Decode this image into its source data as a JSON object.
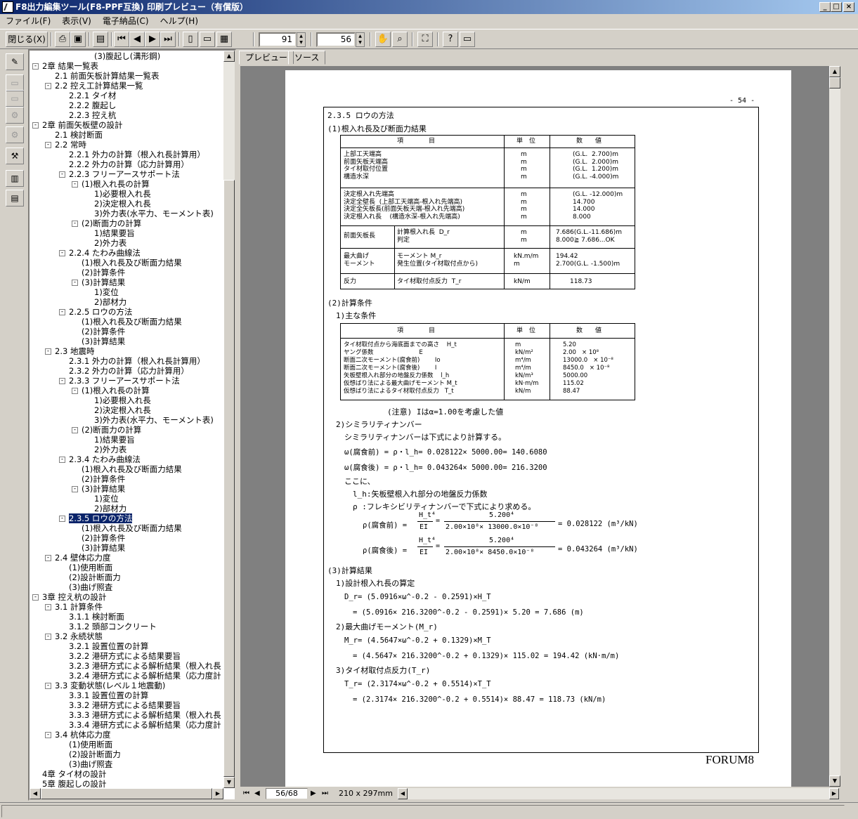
{
  "window": {
    "title": "F8出力編集ツール(F8-PPF互換) 印刷プレビュー（有償版）",
    "min": "_",
    "max": "□",
    "close": "×"
  },
  "menu": [
    "ファイル(F)",
    "表示(V)",
    "電子納品(C)",
    "ヘルプ(H)"
  ],
  "toolbar": {
    "close_label": "閉じる(X)",
    "zoom_value": "91",
    "page_value": "56"
  },
  "tabs": [
    "プレビュー",
    "ソース"
  ],
  "tree": [
    {
      "t": "(3)腹起し(溝形鋼)",
      "d": 4
    },
    {
      "t": "2章 結果一覧表",
      "d": 0,
      "x": "-"
    },
    {
      "t": "2.1 前面矢板計算結果一覧表",
      "d": 1
    },
    {
      "t": "2.2 控え工計算結果一覧",
      "d": 1,
      "x": "-"
    },
    {
      "t": "2.2.1 タイ材",
      "d": 2
    },
    {
      "t": "2.2.2 腹起し",
      "d": 2
    },
    {
      "t": "2.2.3 控え杭",
      "d": 2
    },
    {
      "t": "2章 前面矢板壁の設計",
      "d": 0,
      "x": "-"
    },
    {
      "t": "2.1 検討断面",
      "d": 1
    },
    {
      "t": "2.2 常時",
      "d": 1,
      "x": "-"
    },
    {
      "t": "2.2.1 外力の計算（根入れ長計算用）",
      "d": 2
    },
    {
      "t": "2.2.2 外力の計算（応力計算用）",
      "d": 2
    },
    {
      "t": "2.2.3 フリーアースサポート法",
      "d": 2,
      "x": "-"
    },
    {
      "t": "(1)根入れ長の計算",
      "d": 3,
      "x": "-"
    },
    {
      "t": "1)必要根入れ長",
      "d": 4
    },
    {
      "t": "2)決定根入れ長",
      "d": 4
    },
    {
      "t": "3)外力表(水平力、モーメント表)",
      "d": 4
    },
    {
      "t": "(2)断面力の計算",
      "d": 3,
      "x": "-"
    },
    {
      "t": "1)結果要旨",
      "d": 4
    },
    {
      "t": "2)外力表",
      "d": 4
    },
    {
      "t": "2.2.4 たわみ曲線法",
      "d": 2,
      "x": "-"
    },
    {
      "t": "(1)根入れ長及び断面力結果",
      "d": 3
    },
    {
      "t": "(2)計算条件",
      "d": 3
    },
    {
      "t": "(3)計算結果",
      "d": 3,
      "x": "-"
    },
    {
      "t": "1)変位",
      "d": 4
    },
    {
      "t": "2)部材力",
      "d": 4
    },
    {
      "t": "2.2.5 ロウの方法",
      "d": 2,
      "x": "-"
    },
    {
      "t": "(1)根入れ長及び断面力結果",
      "d": 3
    },
    {
      "t": "(2)計算条件",
      "d": 3
    },
    {
      "t": "(3)計算結果",
      "d": 3
    },
    {
      "t": "2.3 地震時",
      "d": 1,
      "x": "-"
    },
    {
      "t": "2.3.1 外力の計算（根入れ長計算用）",
      "d": 2
    },
    {
      "t": "2.3.2 外力の計算（応力計算用）",
      "d": 2
    },
    {
      "t": "2.3.3 フリーアースサポート法",
      "d": 2,
      "x": "-"
    },
    {
      "t": "(1)根入れ長の計算",
      "d": 3,
      "x": "-"
    },
    {
      "t": "1)必要根入れ長",
      "d": 4
    },
    {
      "t": "2)決定根入れ長",
      "d": 4
    },
    {
      "t": "3)外力表(水平力、モーメント表)",
      "d": 4
    },
    {
      "t": "(2)断面力の計算",
      "d": 3,
      "x": "-"
    },
    {
      "t": "1)結果要旨",
      "d": 4
    },
    {
      "t": "2)外力表",
      "d": 4
    },
    {
      "t": "2.3.4 たわみ曲線法",
      "d": 2,
      "x": "-"
    },
    {
      "t": "(1)根入れ長及び断面力結果",
      "d": 3
    },
    {
      "t": "(2)計算条件",
      "d": 3
    },
    {
      "t": "(3)計算結果",
      "d": 3,
      "x": "-"
    },
    {
      "t": "1)変位",
      "d": 4
    },
    {
      "t": "2)部材力",
      "d": 4
    },
    {
      "t": "2.3.5 ロウの方法",
      "d": 2,
      "x": "-",
      "sel": true
    },
    {
      "t": "(1)根入れ長及び断面力結果",
      "d": 3
    },
    {
      "t": "(2)計算条件",
      "d": 3
    },
    {
      "t": "(3)計算結果",
      "d": 3
    },
    {
      "t": "2.4 壁体応力度",
      "d": 1,
      "x": "-"
    },
    {
      "t": "(1)使用断面",
      "d": 2
    },
    {
      "t": "(2)設計断面力",
      "d": 2
    },
    {
      "t": "(3)曲げ照査",
      "d": 2
    },
    {
      "t": "3章 控え杭の設計",
      "d": 0,
      "x": "-"
    },
    {
      "t": "3.1 計算条件",
      "d": 1,
      "x": "-"
    },
    {
      "t": "3.1.1 検討断面",
      "d": 2
    },
    {
      "t": "3.1.2 頭部コンクリート",
      "d": 2
    },
    {
      "t": "3.2 永続状態",
      "d": 1,
      "x": "-"
    },
    {
      "t": "3.2.1 設置位置の計算",
      "d": 2
    },
    {
      "t": "3.2.2 港研方式による結果要旨",
      "d": 2
    },
    {
      "t": "3.2.3 港研方式による解析結果（根入れ長",
      "d": 2
    },
    {
      "t": "3.2.4 港研方式による解析結果（応力度計",
      "d": 2
    },
    {
      "t": "3.3 変動状態(レベル１地震動)",
      "d": 1,
      "x": "-"
    },
    {
      "t": "3.3.1 設置位置の計算",
      "d": 2
    },
    {
      "t": "3.3.2 港研方式による結果要旨",
      "d": 2
    },
    {
      "t": "3.3.3 港研方式による解析結果（根入れ長",
      "d": 2
    },
    {
      "t": "3.3.4 港研方式による解析結果（応力度計",
      "d": 2
    },
    {
      "t": "3.4 杭体応力度",
      "d": 1,
      "x": "-"
    },
    {
      "t": "(1)使用断面",
      "d": 2
    },
    {
      "t": "(2)設計断面力",
      "d": 2
    },
    {
      "t": "(3)曲げ照査",
      "d": 2
    },
    {
      "t": "4章 タイ材の設計",
      "d": 0
    },
    {
      "t": "5章 腹起しの設計",
      "d": 0
    }
  ],
  "doc": {
    "page_no": "- 54 -",
    "heading": "2.3.5 ロウの方法",
    "s1": "(1)根入れ長及び断面力結果",
    "t1_head": [
      "項　　　　目",
      "単　位",
      "数　　値"
    ],
    "t1_r1a": "上部工天端高\n前面矢板天端高\nタイ材取付位置\n構造水深",
    "t1_r1u": "m\nm\nm\nm",
    "t1_r1v": "(G.L.  2.700)m\n(G.L.  2.000)m\n(G.L.  1.200)m\n(G.L. -4.000)m",
    "t1_r2a": "決定根入れ先端高\n決定全壁長  (上部工天端高-根入れ先端高)\n決定全矢板長(前面矢板天端-根入れ先端高)\n決定根入れ長    (構造水深-根入れ先端高)",
    "t1_r2u": "m\nm\nm\nm",
    "t1_r2v": "(G.L. -12.000)m\n14.700\n14.000\n8.000",
    "t1_r3a": "前面矢板長",
    "t1_r3b": "計算根入れ長  D_r\n判定",
    "t1_r3u": "m\nm",
    "t1_r3v": "7.686(G.L.-11.686)m\n8.000≧ 7.686...OK",
    "t1_r4a": "最大曲げ\nモーメント",
    "t1_r4b": "モーメント M_r\n発生位置(タイ材取付点から)",
    "t1_r4u": "kN.m/m\nm",
    "t1_r4v": "194.42\n2.700(G.L. -1.500)m",
    "t1_r5a": "反力",
    "t1_r5b": "タイ材取付点反力  T_r",
    "t1_r5u": "kN/m",
    "t1_r5v": "118.73",
    "s2": "(2)計算条件",
    "s2_1": "1)主な条件",
    "t2_head": [
      "項　　　　目",
      "単　位",
      "数　　値"
    ],
    "t2_a": "タイ材取付点から海底面までの高さ    H_t\nヤング係数                        E\n断面二次モーメント(腐食前)        Io\n断面二次モーメント(腐食後)        I\n矢板壁根入れ部分の地盤反力係数    l_h\n仮想ばり法による最大曲げモーメント M_t\n仮想ばり法によるタイ材取付点反力   T_t",
    "t2_u": "m\nkN/m²\nm⁴/m\nm⁴/m\nkN/m³\nkN·m/m\nkN/m",
    "t2_v": "5.20\n2.00   × 10⁸\n13000.0   × 10⁻⁸\n8450.0   × 10⁻⁸\n5000.00\n115.02\n88.47",
    "note": "(注意)  Iはα=1.00を考慮した値",
    "s2_2": "2)シミラリティナンバー",
    "s2_2a": "シミラリティナンバーは下式により計算する。",
    "w1": "ω(腐食前) = ρ・l_h=  0.028122×    5000.00=     140.6080",
    "w2": "ω(腐食後) = ρ・l_h=  0.043264×    5000.00=     216.3200",
    "koko": "ここに、",
    "lh": "l_h:矢板壁根入れ部分の地盤反力係数",
    "rho": "ρ  :フレキシビリティナンバーで下式により求める。",
    "r1l": "ρ(腐食前) =",
    "r1n": "H_t⁴",
    "r1d": "EI",
    "r1n2": "5.200⁴",
    "r1d2": "2.00×10⁸×    13000.0×10⁻⁸",
    "r1r": "=  0.028122 (m³/kN)",
    "r2l": "ρ(腐食後) =",
    "r2n2": "5.200⁴",
    "r2d2": "2.00×10⁸×     8450.0×10⁻⁸",
    "r2r": "=  0.043264 (m³/kN)",
    "s3": "(3)計算結果",
    "s3_1": "1)設計根入れ長の算定",
    "f1": "D_r= (5.0916×ω^-0.2 - 0.2591)×H_T",
    "f1b": "= (5.0916×     216.3200^-0.2 - 0.2591)×  5.20 = 7.686 (m)",
    "s3_2": "2)最大曲げモーメント(M_r)",
    "f2": "M_r= (4.5647×ω^-0.2 + 0.1329)×M_T",
    "f2b": "= (4.5647×     216.3200^-0.2 + 0.1329)×   115.02 =  194.42 (kN·m/m)",
    "s3_3": "3)タイ材取付点反力(T_r)",
    "f3": "T_r= (2.3174×ω^-0.2 + 0.5514)×T_T",
    "f3b": "= (2.3174×     216.3200^-0.2 + 0.5514)×    88.47 =  118.73 (kN/m)",
    "brand": "FORUM8"
  },
  "status": {
    "page": "56/68",
    "paper": "210 x 297mm"
  }
}
